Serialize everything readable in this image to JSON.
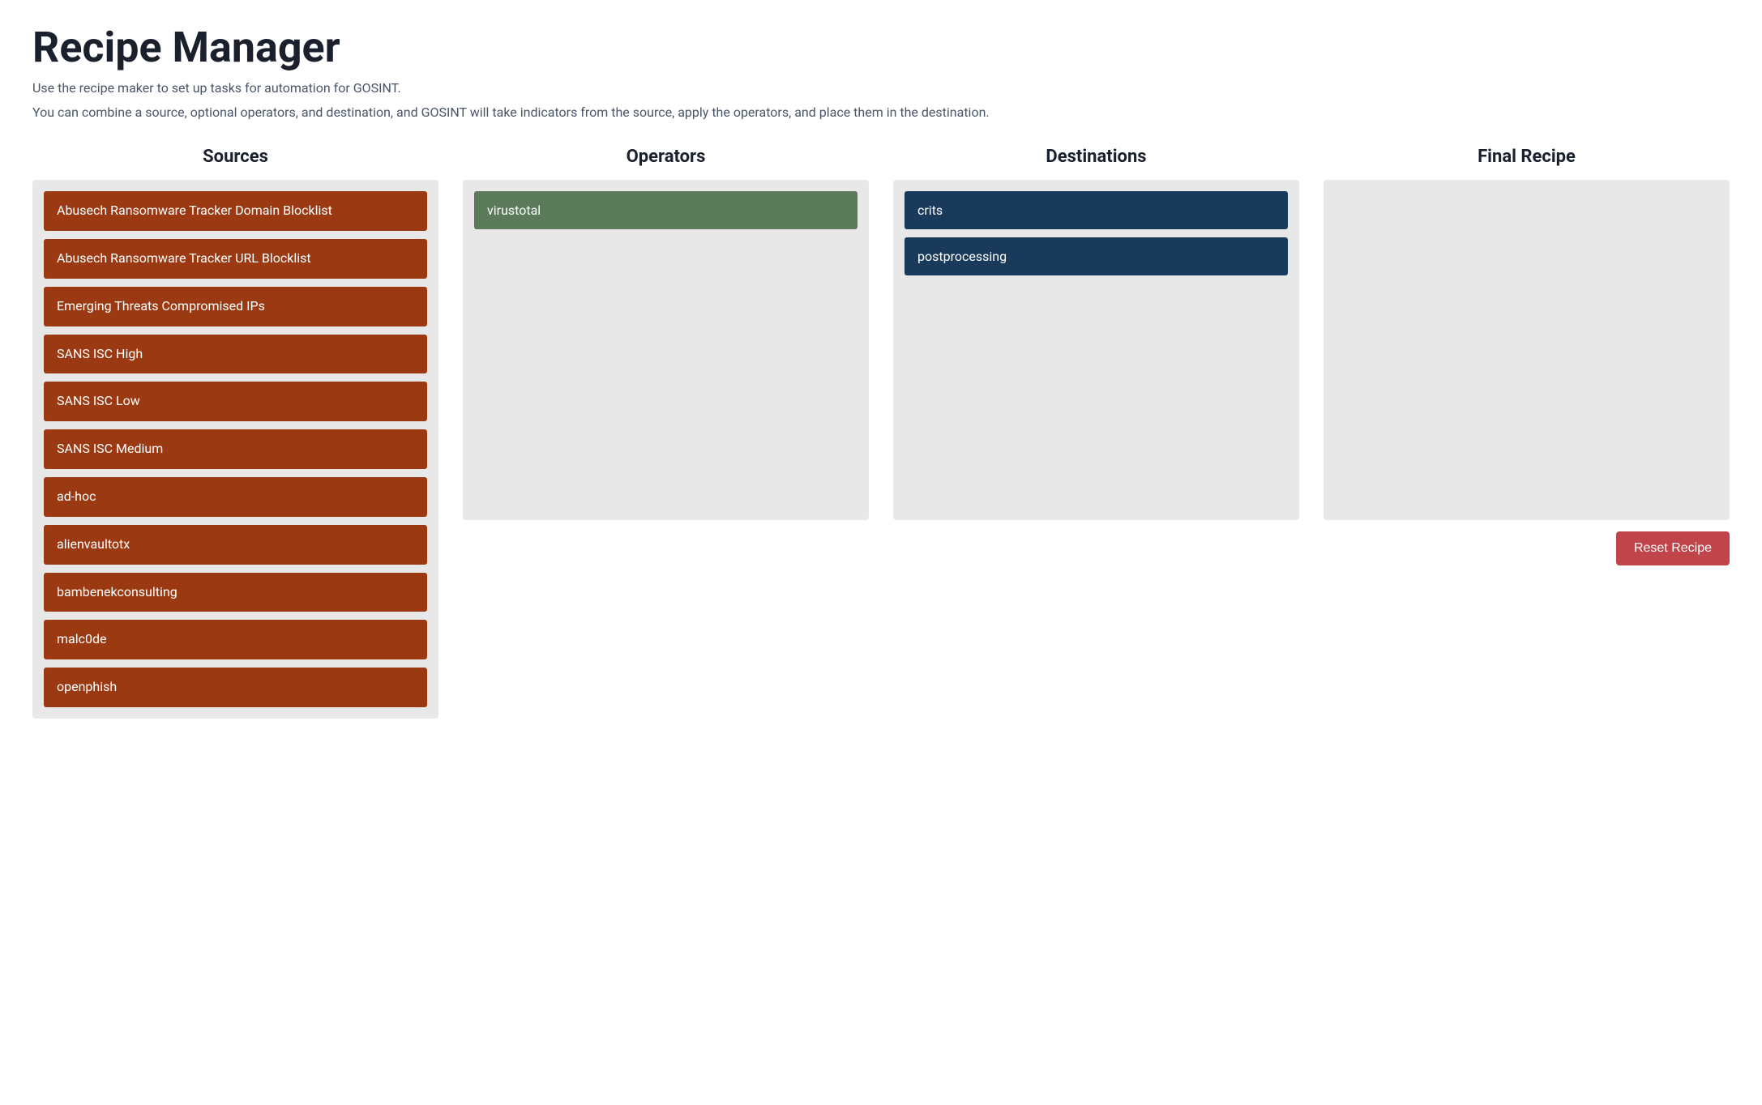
{
  "header": {
    "title": "Recipe Manager",
    "description1": "Use the recipe maker to set up tasks for automation for GOSINT.",
    "description2": "You can combine a source, optional operators, and destination, and GOSINT will take indicators from the source, apply the operators, and place them in the destination."
  },
  "columns": {
    "sources": {
      "heading": "Sources",
      "items": [
        "Abusech Ransomware Tracker Domain Blocklist",
        "Abusech Ransomware Tracker URL Blocklist",
        "Emerging Threats Compromised IPs",
        "SANS ISC High",
        "SANS ISC Low",
        "SANS ISC Medium",
        "ad-hoc",
        "alienvaultotx",
        "bambenekconsulting",
        "malc0de",
        "openphish"
      ]
    },
    "operators": {
      "heading": "Operators",
      "items": [
        "virustotal"
      ]
    },
    "destinations": {
      "heading": "Destinations",
      "items": [
        "crits",
        "postprocessing"
      ]
    },
    "final_recipe": {
      "heading": "Final Recipe"
    }
  },
  "buttons": {
    "reset_recipe": "Reset Recipe"
  }
}
